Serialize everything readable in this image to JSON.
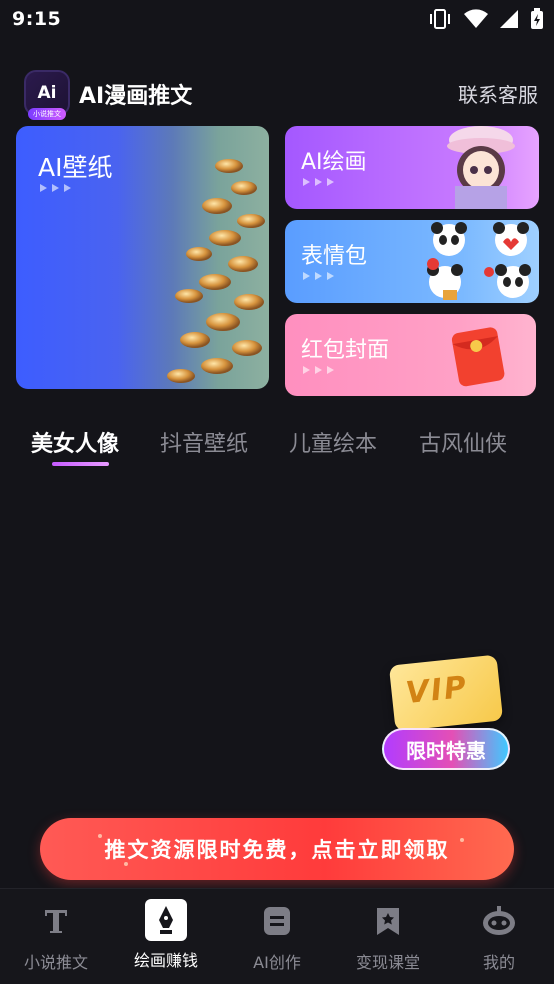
{
  "status_bar": {
    "time": "9:15"
  },
  "header": {
    "logo_mark": "Ai",
    "logo_sub": "小说推文",
    "title": "AI漫画推文",
    "contact": "联系客服"
  },
  "banners": {
    "wallpaper": {
      "label": "AI壁纸"
    },
    "draw": {
      "label": "AI绘画"
    },
    "emoji": {
      "label": "表情包"
    },
    "redpack": {
      "label": "红包封面"
    }
  },
  "tabs": [
    {
      "label": "美女人像",
      "active": true
    },
    {
      "label": "抖音壁纸",
      "active": false
    },
    {
      "label": "儿童绘本",
      "active": false
    },
    {
      "label": "古风仙侠",
      "active": false
    }
  ],
  "vip": {
    "card_text": "VIP",
    "pill_text": "限时特惠"
  },
  "promo": {
    "text": "推文资源限时免费，点击立即领取"
  },
  "bottom_nav": [
    {
      "label": "小说推文",
      "icon": "text-t-icon",
      "active": false
    },
    {
      "label": "绘画赚钱",
      "icon": "pen-nib-icon",
      "active": true
    },
    {
      "label": "AI创作",
      "icon": "document-icon",
      "active": false
    },
    {
      "label": "变现课堂",
      "icon": "bookmark-star-icon",
      "active": false
    },
    {
      "label": "我的",
      "icon": "robot-icon",
      "active": false
    }
  ],
  "colors": {
    "accent": "#c65bff",
    "background": "#141419",
    "promo": "#ff3b3b"
  }
}
